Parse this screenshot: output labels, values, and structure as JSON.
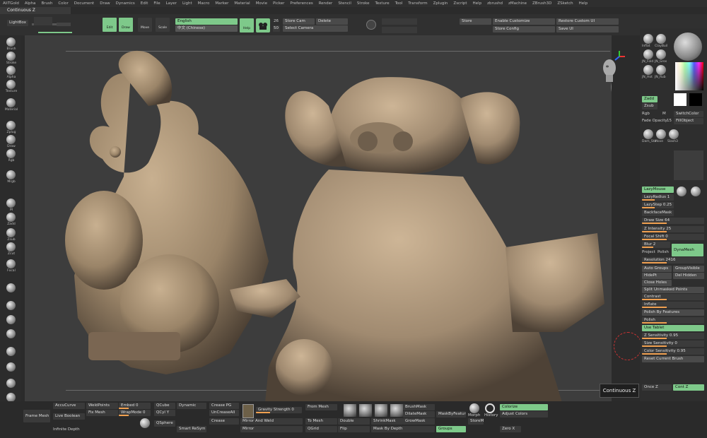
{
  "menubar": [
    "AliTGold",
    "Alpha",
    "Brush",
    "Color",
    "Document",
    "Draw",
    "Dynamics",
    "Edit",
    "File",
    "Layer",
    "Light",
    "Macro",
    "Marker",
    "Material",
    "Movie",
    "Picker",
    "Preferences",
    "Render",
    "Stencil",
    "Stroke",
    "Texture",
    "Tool",
    "Transform",
    "Zplugin",
    "Zscript",
    "Help",
    "zbrushd",
    "zMachine",
    "ZBrush3D",
    "ZSketch",
    "Help"
  ],
  "title": "Continuous Z",
  "top": {
    "lightbox": "LightBox",
    "edit": "Edit",
    "draw": "Draw",
    "move": "Move",
    "scale": "Scale",
    "rotate": "Rotate",
    "language_selected": "English",
    "language_alt": "中文 (Chinese)",
    "help": "Help",
    "store_cam": "Store Cam",
    "delete": "Delete",
    "select_camera": "Select Camera",
    "num_a": "26",
    "num_b": "50",
    "store": "Store",
    "enable_customize": "Enable Customize",
    "restore_custom_ui": "Restore Custom UI",
    "store_config": "Store Config",
    "save_ui": "Save UI"
  },
  "left": [
    "Brush",
    "Stroke",
    "Alpha",
    "Texture",
    "Material",
    "Zplug",
    "Draw",
    "Rgb",
    "Mrgb",
    "M",
    "Zadd",
    "Zsub",
    "Zcut",
    "Focal"
  ],
  "right": {
    "brushes": [
      "Inflat",
      "ClayBuil",
      "JN_Fold",
      "JN_Gros",
      "JN_Hot",
      "JN_Rub",
      "Dam_Sta",
      "Move",
      "Slash3"
    ],
    "zadd": "Zadd",
    "zsub": "Zsub",
    "rgb": "Rgb",
    "m": "M",
    "switch_color": "SwitchColor",
    "fade_opacity": "Fade Opacity",
    "fade_val": "15",
    "fill_object": "FillObject",
    "lazymouse": "LazyMouse",
    "lazyradius": "LazyRadius 1",
    "lazystep": "LazyStep 0.25",
    "backfacemask": "BackfaceMask",
    "draw_size": "Draw Size 64",
    "dynamic": "Dynamic",
    "z_intensity": "Z Intensity 25",
    "focal_shift": "Focal Shift 0",
    "blur": "Blur 2",
    "groups": "Groups",
    "project": "Project",
    "polish": "Polish",
    "dynamesh": "DynaMesh",
    "resolution": "Resolution 2416",
    "auto_groups": "Auto Groups",
    "group_visible": "GroupVisible",
    "hidept": "HidePt",
    "del_hidden": "Del Hidden",
    "close_holes": "Close Holes",
    "split_unmasked": "Split Unmasked Points",
    "contrast": "Contrast",
    "inflate": "Inflate",
    "polish_by_features": "Polish By Features",
    "polish2": "Polish",
    "use_tablet": "Use Tablet",
    "z_sensitivity": "Z Sensitivity 0.95",
    "size_sensitivity": "Size Sensitivity 0",
    "color_sensitivity": "Color Sensitivity 0.95",
    "reset_brush": "Reset Current Brush",
    "once_z": "Once Z",
    "cont_z": "Cont Z"
  },
  "bottom": {
    "frame_mesh": "Frame Mesh",
    "accucurve": "AccuCurve",
    "live_boolean": "Live Boolean",
    "weldpoints": "WeldPoints",
    "fix_mesh": "Fix Mesh",
    "embed": "Embed 0",
    "wrapmode": "WrapMode 0",
    "qcube": "QCube",
    "qcyl": "QCyl Y",
    "qsphere": "QSphere",
    "dynamic": "Dynamic",
    "uncrease": "UnCreaseAll",
    "crease_pg": "Crease PG",
    "crease": "Crease",
    "gravity": "Gravity Strength 0",
    "from_mesh": "From Mesh",
    "to_mesh": "To Mesh",
    "double": "Double",
    "flip": "Flip",
    "mirror_weld": "Mirror And Weld",
    "mirror": "Mirror",
    "qgrid": "QGrid",
    "smart_resym": "Smart ReSym",
    "brushmask": "BrushMask",
    "dilatemask": "DilateMask",
    "shrinkmask": "ShrinkMask",
    "growmask": "GrowMask",
    "mask_by_depth": "Mask By Depth",
    "maskbyfeature": "MaskByFeature",
    "groups": "Groups",
    "store_mt": "StoreMT",
    "morph": "Morph",
    "history": "History",
    "colorize": "Colorize",
    "adjust_colors": "Adjust Colors",
    "zero_x": "Zero X",
    "infinite_depth": "Infinite Depth",
    "continuous_z": "Continuous Z"
  },
  "colors": {
    "accent_green": "#7ec98a",
    "orange": "#f0a050",
    "model": "#a08a70"
  }
}
